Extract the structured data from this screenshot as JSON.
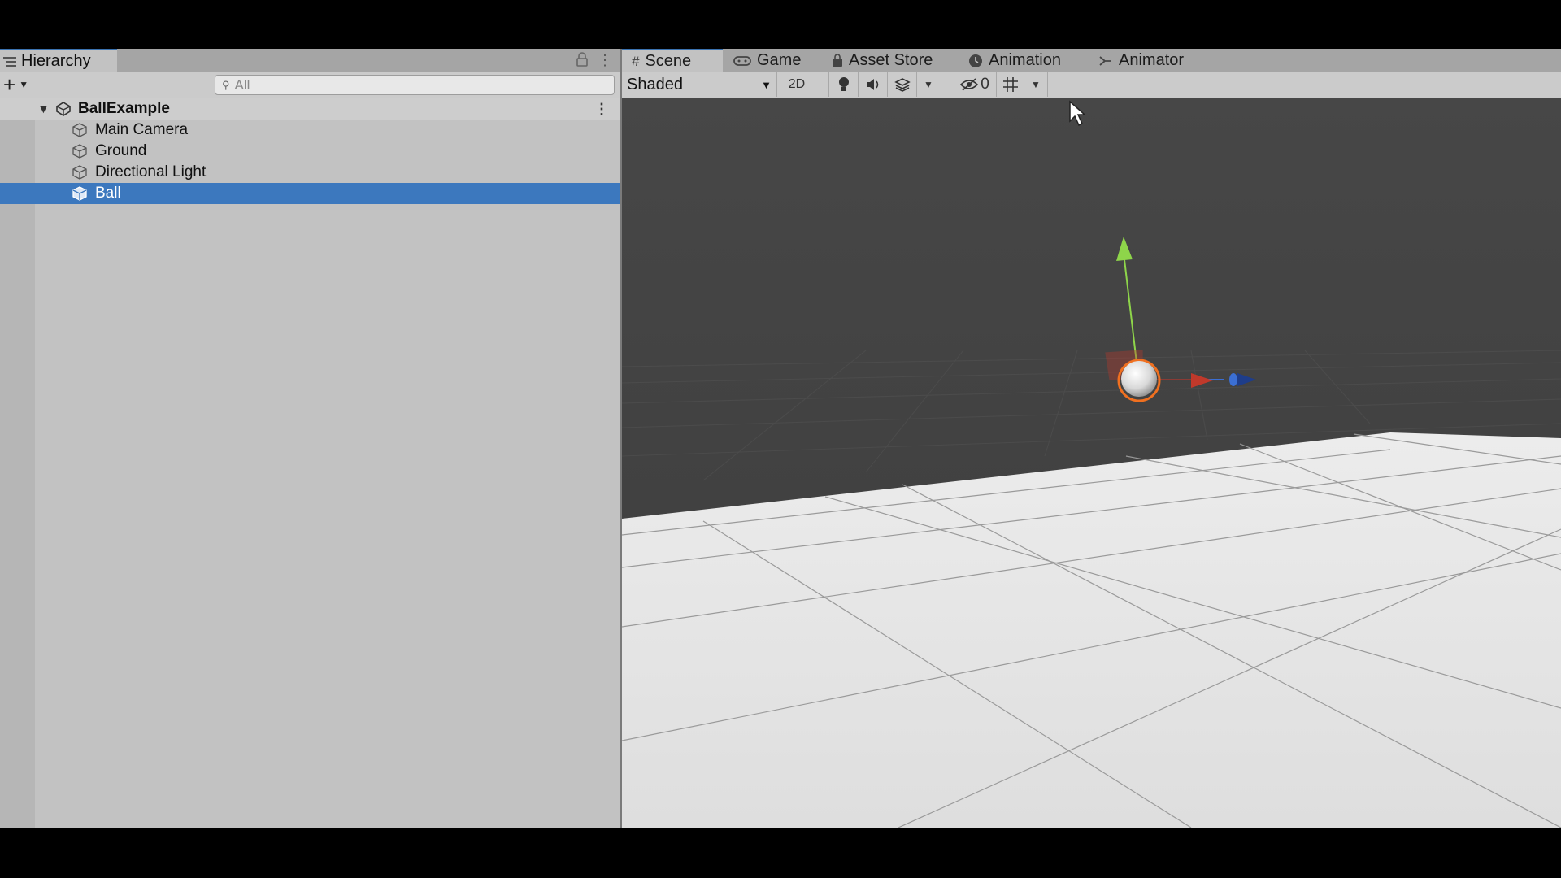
{
  "hierarchy": {
    "tab_label": "Hierarchy",
    "search_placeholder": "All",
    "scene_name": "BallExample",
    "items": [
      {
        "label": "Main Camera",
        "selected": false
      },
      {
        "label": "Ground",
        "selected": false
      },
      {
        "label": "Directional Light",
        "selected": false
      },
      {
        "label": "Ball",
        "selected": true
      }
    ]
  },
  "scene_panel": {
    "tabs": [
      {
        "label": "Scene",
        "icon": "grid-icon",
        "active": true
      },
      {
        "label": "Game",
        "icon": "gamepad-icon",
        "active": false
      },
      {
        "label": "Asset Store",
        "icon": "bag-icon",
        "active": false
      },
      {
        "label": "Animation",
        "icon": "clock-icon",
        "active": false
      },
      {
        "label": "Animator",
        "icon": "animator-icon",
        "active": false
      }
    ],
    "shading_mode": "Shaded",
    "mode_2d": "2D",
    "hidden_count": "0"
  },
  "colors": {
    "selection": "#3c78be",
    "accent_tab": "#3a72b0",
    "gizmo_y": "#8ed54a",
    "gizmo_x": "#c0392b",
    "gizmo_z": "#3b6fd4",
    "selection_outline": "#f07020"
  }
}
